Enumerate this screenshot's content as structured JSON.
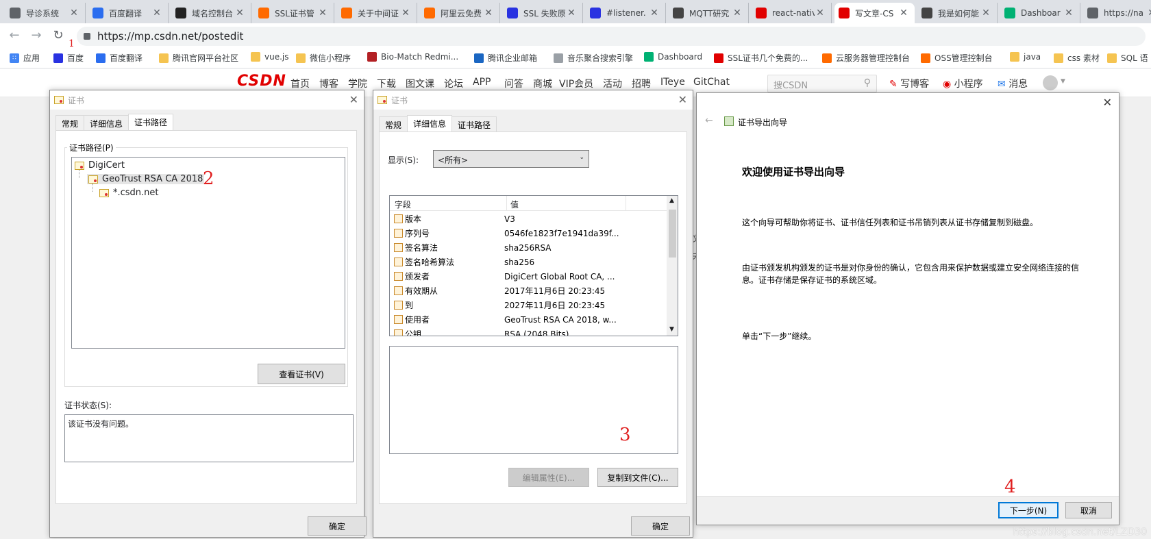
{
  "browser": {
    "tabs": [
      {
        "title": "导诊系统",
        "icon": "page-icon",
        "color": "#5f6368"
      },
      {
        "title": "百度翻译",
        "icon": "baidu-translate-icon",
        "color": "#2b6def"
      },
      {
        "title": "域名控制台",
        "icon": "aliyun-icon",
        "color": "#222222"
      },
      {
        "title": "SSL证书管",
        "icon": "aliyun-icon",
        "color": "#ff6a00"
      },
      {
        "title": "关于中间证",
        "icon": "aliyun-icon",
        "color": "#ff6a00"
      },
      {
        "title": "阿里云免费",
        "icon": "aliyun-icon",
        "color": "#ff6a00"
      },
      {
        "title": "SSL 失败原",
        "icon": "baidu-paw-icon",
        "color": "#2932e1"
      },
      {
        "title": "#listener.",
        "icon": "baidu-paw-icon",
        "color": "#2932e1"
      },
      {
        "title": "MQTT研究",
        "icon": "juejin-icon",
        "color": "#444444"
      },
      {
        "title": "react-nativ",
        "icon": "csdn-icon",
        "color": "#e10000"
      },
      {
        "title": "写文章-CS",
        "icon": "csdn-icon",
        "color": "#e10000",
        "active": true
      },
      {
        "title": "我是如何能",
        "icon": "juejin-icon",
        "color": "#444444"
      },
      {
        "title": "Dashboar",
        "icon": "emq-icon",
        "color": "#00b173"
      },
      {
        "title": "https://na",
        "icon": "page-icon",
        "color": "#5f6368"
      }
    ],
    "url": "https://mp.csdn.net/postedit",
    "bookmarks": [
      {
        "label": "应用",
        "icon": "apps-grid-icon"
      },
      {
        "label": "百度",
        "icon": "baidu-paw-icon"
      },
      {
        "label": "百度翻译",
        "icon": "baidu-translate-icon"
      },
      {
        "label": "腾讯官网平台社区",
        "icon": "folder-icon"
      },
      {
        "label": "vue.js",
        "icon": "folder-icon"
      },
      {
        "label": "微信小程序",
        "icon": "folder-icon"
      },
      {
        "label": "Bio-Match Redmi...",
        "icon": "redmine-icon"
      },
      {
        "label": "腾讯企业邮箱",
        "icon": "tencent-mail-icon"
      },
      {
        "label": "音乐聚合搜索引擎",
        "icon": "page-icon"
      },
      {
        "label": "Dashboard",
        "icon": "emq-icon"
      },
      {
        "label": "SSL证书几个免费的...",
        "icon": "csdn-icon"
      },
      {
        "label": "云服务器管理控制台",
        "icon": "aliyun-icon"
      },
      {
        "label": "OSS管理控制台",
        "icon": "aliyun-icon"
      },
      {
        "label": "java",
        "icon": "folder-icon"
      },
      {
        "label": "css 素材",
        "icon": "folder-icon"
      },
      {
        "label": "SQL 语",
        "icon": "folder-icon"
      }
    ]
  },
  "csdn": {
    "logo": "CSDN",
    "nav": [
      "首页",
      "博客",
      "学院",
      "下载",
      "图文课",
      "论坛",
      "APP",
      "问答",
      "商城",
      "VIP会员",
      "活动",
      "招聘",
      "ITeye",
      "GitChat"
    ],
    "search_placeholder": "搜CSDN",
    "actions": [
      "写博客",
      "小程序",
      "消息"
    ]
  },
  "dialog1": {
    "title": "证书",
    "tabs": [
      "常规",
      "详细信息",
      "证书路径"
    ],
    "selected_tab": "证书路径",
    "path_group_label": "证书路径(P)",
    "path": [
      "DigiCert",
      "GeoTrust RSA CA 2018",
      "*.csdn.net"
    ],
    "view_button": "查看证书(V)",
    "status_label": "证书状态(S):",
    "status_text": "该证书没有问题。",
    "ok_button": "确定"
  },
  "dialog2": {
    "title": "证书",
    "tabs": [
      "常规",
      "详细信息",
      "证书路径"
    ],
    "selected_tab": "详细信息",
    "show_label": "显示(S):",
    "show_value": "<所有>",
    "columns": [
      "字段",
      "值"
    ],
    "rows": [
      {
        "field": "版本",
        "value": "V3"
      },
      {
        "field": "序列号",
        "value": "0546fe1823f7e1941da39f..."
      },
      {
        "field": "签名算法",
        "value": "sha256RSA"
      },
      {
        "field": "签名哈希算法",
        "value": "sha256"
      },
      {
        "field": "颁发者",
        "value": "DigiCert Global Root CA, ..."
      },
      {
        "field": "有效期从",
        "value": "2017年11月6日 20:23:45"
      },
      {
        "field": "到",
        "value": "2027年11月6日 20:23:45"
      },
      {
        "field": "使用者",
        "value": "GeoTrust RSA CA 2018, w..."
      },
      {
        "field": "公钥",
        "value": "RSA (2048 Bits)"
      }
    ],
    "edit_button": "编辑属性(E)...",
    "copy_button": "复制到文件(C)...",
    "ok_button": "确定"
  },
  "wizard": {
    "title": "证书导出向导",
    "heading": "欢迎使用证书导出向导",
    "para1": "这个向导可帮助你将证书、证书信任列表和证书吊销列表从证书存储复制到磁盘。",
    "para2": "由证书颁发机构颁发的证书是对你身份的确认，它包含用来保护数据或建立安全网络连接的信息。证书存储是保存证书的系统区域。",
    "para3": "单击“下一步”继续。",
    "next_button": "下一步(N)",
    "cancel_button": "取消"
  },
  "annotations": [
    "1",
    "2",
    "3",
    "4"
  ],
  "watermark": "https://blog.csdn.net/LZD30",
  "colors": {
    "annotation": "#e02020",
    "csdn_red": "#e10000",
    "accent": "#0078d7"
  }
}
